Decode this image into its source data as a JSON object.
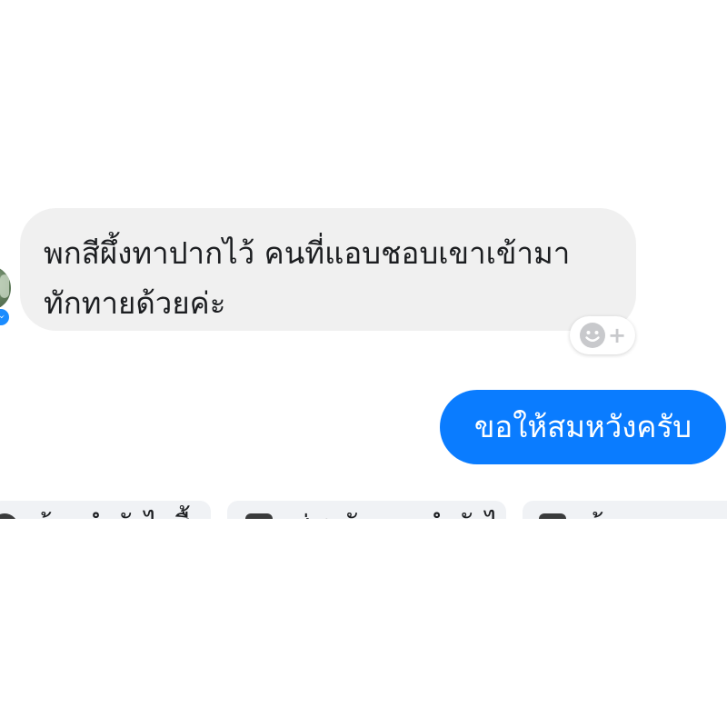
{
  "conversation": {
    "incoming_message": {
      "lines": [
        "พกสีผึ้งทาปากไว้ คนที่แอบชอบเขาเข้ามา",
        "ทักทายด้วยค่ะ"
      ],
      "bubble_color": "#f0f0f0"
    },
    "reaction_button": {
      "icon": "smiley-add-icon",
      "plus": "+"
    },
    "outgoing_message": {
      "text": "ขอให้สมหวังครับ",
      "bubble_color": "#0a7cff"
    }
  },
  "quick_replies": [
    {
      "icon": "reply-icon",
      "label": "ต้องทำยังไงซื้อ"
    },
    {
      "icon": "chat-icon",
      "label": "ส่งหลักฐานทำยังไงซื้อ"
    },
    {
      "icon": "chat-icon",
      "label": "ต้องการ"
    }
  ],
  "colors": {
    "accent": "#0a7cff",
    "messenger_badge": "#1a8cff"
  }
}
